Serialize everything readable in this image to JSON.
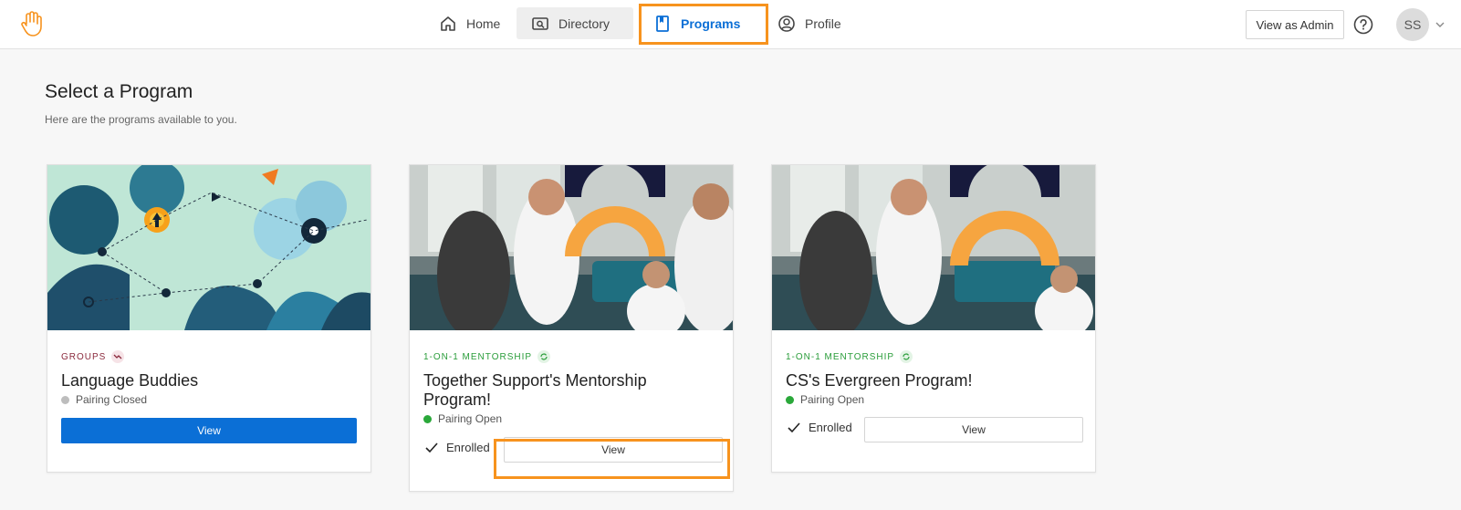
{
  "nav": {
    "items": [
      {
        "label": "Home",
        "icon": "home-icon"
      },
      {
        "label": "Directory",
        "icon": "directory-icon"
      },
      {
        "label": "Programs",
        "icon": "book-icon"
      },
      {
        "label": "Profile",
        "icon": "profile-icon"
      }
    ],
    "active": "Programs",
    "admin_button": "View as Admin",
    "avatar_initials": "SS"
  },
  "page": {
    "title": "Select a Program",
    "subtitle": "Here are the programs available to you."
  },
  "programs": [
    {
      "type": "GROUPS",
      "title": "Language Buddies",
      "status": "Pairing Closed",
      "enrolled": "",
      "button": "View"
    },
    {
      "type": "1-ON-1 MENTORSHIP",
      "title": "Together Support's Mentorship Program!",
      "status": "Pairing Open",
      "enrolled": "Enrolled",
      "button": "View"
    },
    {
      "type": "1-ON-1 MENTORSHIP",
      "title": "CS's Evergreen Program!",
      "status": "Pairing Open",
      "enrolled": "Enrolled",
      "button": "View"
    }
  ],
  "colors": {
    "accent": "#0b6fd6",
    "highlight": "#f7931e",
    "groups_tag": "#8b2a3d",
    "mentor_tag": "#2a9d3a",
    "status_open": "#2aa83a",
    "status_closed": "#bdbdbd"
  }
}
